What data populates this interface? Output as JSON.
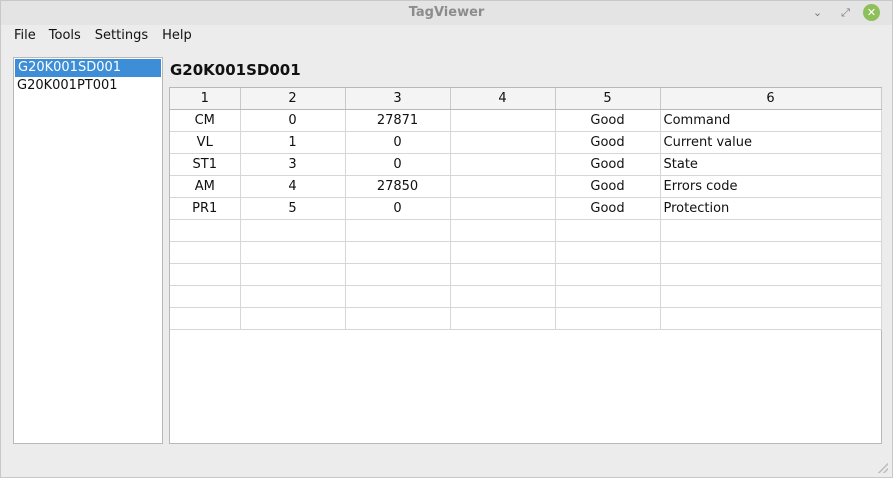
{
  "window": {
    "title": "TagViewer",
    "min_glyph": "⌄",
    "max_glyph": "⤢",
    "close_glyph": "✕"
  },
  "menu": {
    "file": "File",
    "tools": "Tools",
    "settings": "Settings",
    "help": "Help"
  },
  "tags": [
    {
      "label": "G20K001SD001",
      "selected": true
    },
    {
      "label": "G20K001PT001",
      "selected": false
    }
  ],
  "current_tag": "G20K001SD001",
  "table": {
    "headers": [
      "1",
      "2",
      "3",
      "4",
      "5",
      "6"
    ],
    "rows": [
      [
        "CM",
        "0",
        "27871",
        "",
        "Good",
        "Command"
      ],
      [
        "VL",
        "1",
        "0",
        "",
        "Good",
        "Current value"
      ],
      [
        "ST1",
        "3",
        "0",
        "",
        "Good",
        "State"
      ],
      [
        "AM",
        "4",
        "27850",
        "",
        "Good",
        "Errors code"
      ],
      [
        "PR1",
        "5",
        "0",
        "",
        "Good",
        "Protection"
      ],
      [
        "",
        "",
        "",
        "",
        "",
        ""
      ],
      [
        "",
        "",
        "",
        "",
        "",
        ""
      ],
      [
        "",
        "",
        "",
        "",
        "",
        ""
      ],
      [
        "",
        "",
        "",
        "",
        "",
        ""
      ],
      [
        "",
        "",
        "",
        "",
        "",
        ""
      ]
    ]
  },
  "colors": {
    "selection": "#3d8ed6",
    "close_button": "#8fbf5a"
  }
}
